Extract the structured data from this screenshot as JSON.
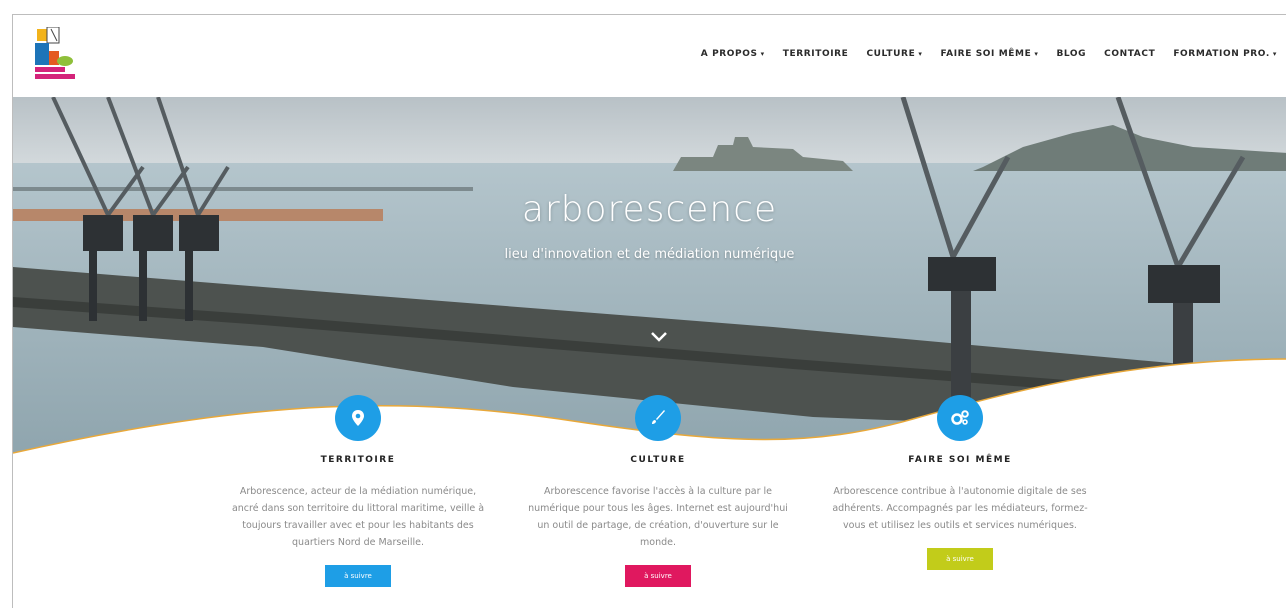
{
  "nav": {
    "items": [
      {
        "label": "A PROPOS",
        "dropdown": true
      },
      {
        "label": "TERRITOIRE",
        "dropdown": false
      },
      {
        "label": "CULTURE",
        "dropdown": true
      },
      {
        "label": "FAIRE SOI MÊME",
        "dropdown": true
      },
      {
        "label": "BLOG",
        "dropdown": false
      },
      {
        "label": "CONTACT",
        "dropdown": false
      },
      {
        "label": "FORMATION PRO.",
        "dropdown": true
      }
    ],
    "caret": "▾"
  },
  "hero": {
    "title": "arborescence",
    "subtitle": "lieu d'innovation et de médiation numérique",
    "scroll_icon": "chevron-down-icon"
  },
  "features": [
    {
      "icon": "map-pin-icon",
      "color": "#1e9ee6",
      "title": "TERRITOIRE",
      "text": "Arborescence, acteur de la médiation numérique, ancré dans son territoire du littoral maritime, veille à toujours travailler avec et pour les habitants des quartiers Nord de Marseille.",
      "button": "à suivre",
      "button_color": "#1e9ee6"
    },
    {
      "icon": "paintbrush-icon",
      "color": "#1e9ee6",
      "title": "CULTURE",
      "text": "Arborescence favorise l'accès à la culture par le numérique pour tous les âges. Internet est aujourd'hui un outil de partage, de création, d'ouverture sur le monde.",
      "button": "à suivre",
      "button_color": "#e0185f"
    },
    {
      "icon": "gears-icon",
      "color": "#1e9ee6",
      "title": "FAIRE SOI MÊME",
      "text": "Arborescence contribue à l'autonomie digitale de ses adhérents. Accompagnés par les médiateurs, formez-vous et utilisez les outils et services numériques.",
      "button": "à suivre",
      "button_color": "#c2cc1a"
    }
  ],
  "colors": {
    "wave_accent": "#e8a83a",
    "sea": "#aebfc7",
    "sky": "#cfd6da"
  }
}
